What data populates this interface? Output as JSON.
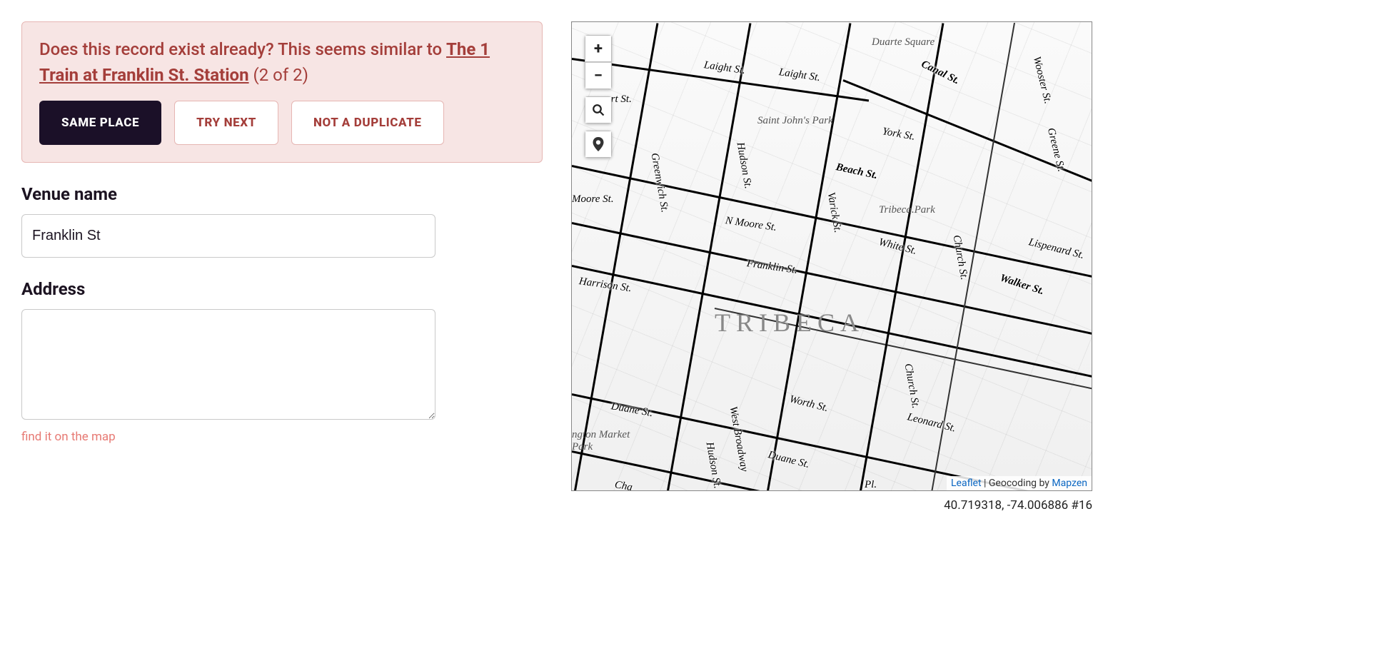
{
  "alert": {
    "prompt": "Does this record exist already? This seems similar to ",
    "similar_name": "The 1 Train at Franklin St. Station",
    "counter": " (2 of 2)",
    "same_place": "Same Place",
    "try_next": "Try Next",
    "not_duplicate": "Not a Duplicate"
  },
  "form": {
    "venue_label": "Venue name",
    "venue_value": "Franklin St",
    "address_label": "Address",
    "address_value": "",
    "find_link": "find it on the map"
  },
  "map": {
    "district": "TRIBECA",
    "parks": {
      "saint_johns": "Saint John's Park",
      "tribeca_park": "Tribeca.Park",
      "duarte": "Duarte Square",
      "wash_market": "ngton Market\nPark"
    },
    "streets": {
      "laight": "Laight St.",
      "laight2": "Laight St.",
      "canal": "Canal St.",
      "york": "York St.",
      "beach": "Beach St.",
      "n_moore": "N Moore St.",
      "moore": "Moore St.",
      "franklin": "Franklin St.",
      "white": "White St.",
      "harrison": "Harrison St.",
      "walker": "Walker St.",
      "lispenard": "Lispenard St.",
      "ert": "ert St.",
      "greenwich": "Greenwich St.",
      "hudson": "Hudson St.",
      "varick": "Varick St.",
      "church": "Church St.",
      "w_broadway": "West Broadway",
      "worth": "Worth St.",
      "duane": "Duane St.",
      "duane2": "Duane St.",
      "leonard": "Leonard St.",
      "cha": "Cha",
      "pl": "Pl.",
      "hudson2": "Hudson St.",
      "greene": "Greene St.",
      "wooster": "Wooster St.",
      "church2": "Church St."
    },
    "zoom_in": "+",
    "zoom_out": "−",
    "attribution": {
      "leaflet": "Leaflet",
      "sep": " | Geocoding by ",
      "mapzen": "Mapzen"
    },
    "coords": "40.719318, -74.006886 #16"
  }
}
